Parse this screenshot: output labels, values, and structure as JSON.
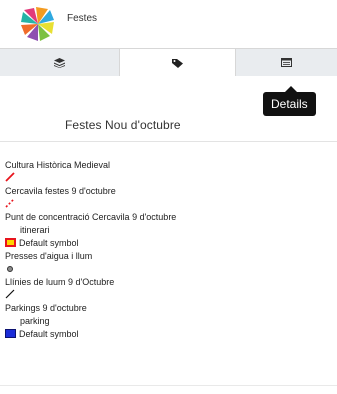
{
  "header": {
    "app_title": "Festes"
  },
  "tabs": [
    {
      "icon": "layers-icon"
    },
    {
      "icon": "tag-icon"
    },
    {
      "icon": "details-icon"
    }
  ],
  "tooltip": {
    "text": "Details"
  },
  "panel": {
    "title": "Festes Nou d'octubre"
  },
  "legend": {
    "items": [
      {
        "label": "Cultura Històrica Medieval"
      },
      {
        "label": "Cercavila festes 9 d'octubre"
      },
      {
        "label": "Punt de concentració Cercavila 9 d'octubre"
      },
      {
        "label": "itinerari"
      },
      {
        "label": "Default symbol"
      },
      {
        "label": "Presses d'aigua i llum"
      },
      {
        "label": "Llínies de luum 9 d'Octubre"
      },
      {
        "label": "Parkings 9 d'octubre"
      },
      {
        "label": "parking"
      },
      {
        "label": "Default symbol"
      }
    ]
  },
  "colors": {
    "tab_inactive": "#e9ecef",
    "tab_active": "#ffffff",
    "tooltip_bg": "#111111",
    "line_red": "#e8141c",
    "symbol_yellow": "#ffd400",
    "symbol_blue": "#1b2cd8"
  }
}
